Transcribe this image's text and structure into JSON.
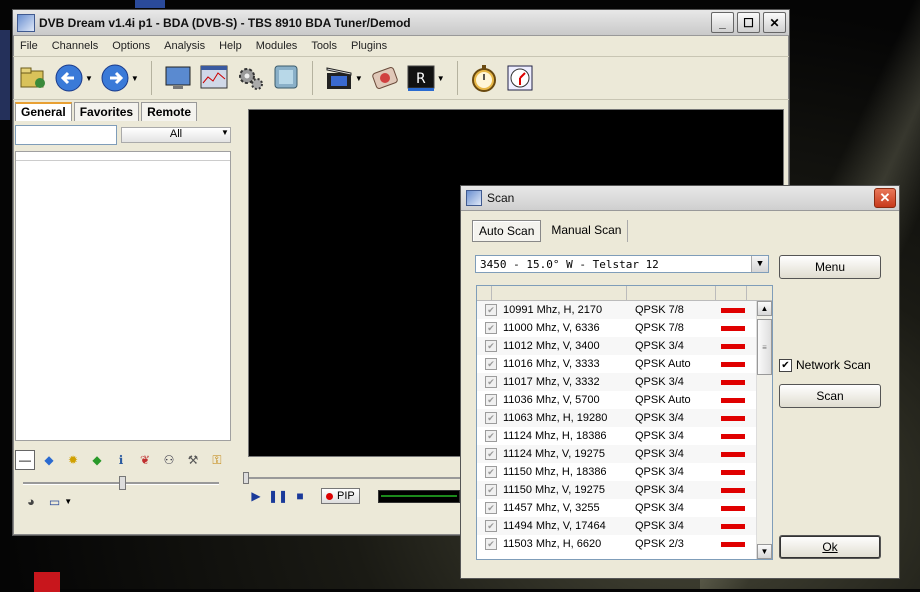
{
  "main_window": {
    "title": "DVB Dream v1.4i p1 - BDA (DVB-S)  -  TBS 8910 BDA Tuner/Demod",
    "minimize": "_",
    "maximize": "☐",
    "close": "✕"
  },
  "menu": [
    "File",
    "Channels",
    "Options",
    "Analysis",
    "Help",
    "Modules",
    "Tools",
    "Plugins"
  ],
  "left_panel": {
    "tabs": [
      "General",
      "Favorites",
      "Remote"
    ],
    "active_tab": "General",
    "filter_value": "",
    "filter_select": "All"
  },
  "player": {
    "pip_label": "PIP"
  },
  "scan_dialog": {
    "title": "Scan",
    "close": "✕",
    "tabs": [
      "Auto Scan",
      "Manual Scan"
    ],
    "active_tab": "Auto Scan",
    "satellite": "3450 - 15.0° W - Telstar 12",
    "menu_button": "Menu",
    "network_scan_label": "Network Scan",
    "network_scan_checked": true,
    "scan_button": "Scan",
    "ok_button": "Ok",
    "transponders": [
      {
        "freq": "10991 Mhz, H, 2170",
        "mod": "QPSK 7/8"
      },
      {
        "freq": "11000 Mhz, V, 6336",
        "mod": "QPSK 7/8"
      },
      {
        "freq": "11012 Mhz, V, 3400",
        "mod": "QPSK 3/4"
      },
      {
        "freq": "11016 Mhz, V, 3333",
        "mod": "QPSK Auto"
      },
      {
        "freq": "11017 Mhz, V, 3332",
        "mod": "QPSK 3/4"
      },
      {
        "freq": "11036 Mhz, V, 5700",
        "mod": "QPSK Auto"
      },
      {
        "freq": "11063 Mhz, H, 19280",
        "mod": "QPSK 3/4"
      },
      {
        "freq": "11124 Mhz, H, 18386",
        "mod": "QPSK 3/4"
      },
      {
        "freq": "11124 Mhz, V, 19275",
        "mod": "QPSK 3/4"
      },
      {
        "freq": "11150 Mhz, H, 18386",
        "mod": "QPSK 3/4"
      },
      {
        "freq": "11150 Mhz, V, 19275",
        "mod": "QPSK 3/4"
      },
      {
        "freq": "11457 Mhz, V, 3255",
        "mod": "QPSK 3/4"
      },
      {
        "freq": "11494 Mhz, V, 17464",
        "mod": "QPSK 3/4"
      },
      {
        "freq": "11503 Mhz, H, 6620",
        "mod": "QPSK 2/3"
      }
    ]
  },
  "colors": {
    "signal_bar": "#e00000",
    "video_bg": "#000000"
  }
}
